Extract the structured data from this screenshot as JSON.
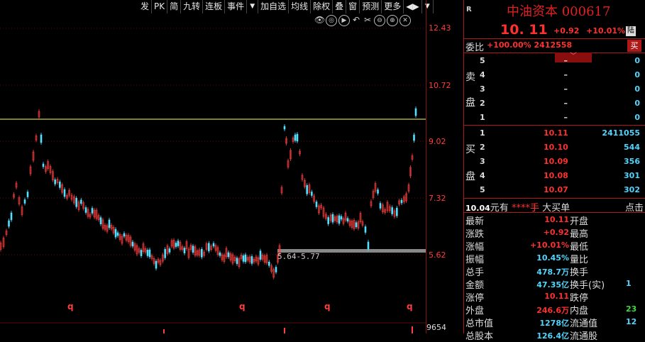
{
  "toolbar": [
    "发",
    "PK",
    "简",
    "九转",
    "连板",
    "事件",
    "▼",
    "加自选",
    "均线",
    "除权",
    "叠",
    "窗",
    "预测",
    "更多",
    "◀▶",
    "▼"
  ],
  "chart_icons": [
    "eye-icon",
    "zoom-out-icon",
    "play-icon",
    "undo-icon",
    "crossline-icon",
    "zoom-minus-icon",
    "zoom-plus-icon",
    "close-icon"
  ],
  "axis_ticks": [
    "12.43",
    "10.72",
    "9.02",
    "7.32",
    "5.62"
  ],
  "volume_axis": "9654",
  "range_label": "5.64-5.77",
  "q_markers": [
    "q",
    "q",
    "q",
    "q"
  ],
  "stock": {
    "corner": "R",
    "title": "中油资本 000617",
    "price": "10. 11",
    "change": "+0.92",
    "change_pct": "+10.01%",
    "market": "陆"
  },
  "weibi": {
    "label": "委比",
    "value": "+100.00% 2412558",
    "buy": "买"
  },
  "sell_label": [
    "卖",
    "盘"
  ],
  "buy_label": [
    "买",
    "盘"
  ],
  "sell_orders": [
    {
      "level": "5",
      "price": "–",
      "vol": "0"
    },
    {
      "level": "4",
      "price": "–",
      "vol": "0"
    },
    {
      "level": "3",
      "price": "–",
      "vol": "0"
    },
    {
      "level": "2",
      "price": "–",
      "vol": "0"
    },
    {
      "level": "1",
      "price": "–",
      "vol": "0"
    }
  ],
  "buy_orders": [
    {
      "level": "1",
      "price": "10.11",
      "vol": "2411055"
    },
    {
      "level": "2",
      "price": "10.10",
      "vol": "544"
    },
    {
      "level": "3",
      "price": "10.09",
      "vol": "356"
    },
    {
      "level": "4",
      "price": "10.08",
      "vol": "301"
    },
    {
      "level": "5",
      "price": "10.07",
      "vol": "302"
    }
  ],
  "tape": {
    "price": "10.04",
    "text": "元有 ",
    "stars": "****手",
    "big": " 大买单",
    "click": "点击"
  },
  "stats": [
    {
      "l": "最新",
      "v": "10.11",
      "r": "开盘",
      "rv": ""
    },
    {
      "l": "涨跌",
      "v": "+0.92",
      "r": "最高",
      "rv": ""
    },
    {
      "l": "涨幅",
      "v": "+10.01%",
      "r": "最低",
      "rv": ""
    },
    {
      "l": "振幅",
      "v": "10.45%",
      "r": "量比",
      "rv": ""
    },
    {
      "l": "总手",
      "v": "478.7万",
      "r": "换手",
      "rv": ""
    },
    {
      "l": "金额",
      "v": "47.35亿",
      "r": "换手(实)",
      "rv": "1"
    },
    {
      "l": "涨停",
      "v": "10.11",
      "r": "跌停",
      "rv": ""
    },
    {
      "l": "外盘",
      "v": "246.6万",
      "r": "内盘",
      "rv": "23"
    },
    {
      "l": "总市值",
      "v": "1278亿",
      "r": "流通值",
      "rv": "12"
    },
    {
      "l": "总股本",
      "v": "126.4亿",
      "r": "流通股",
      "rv": ""
    }
  ]
}
